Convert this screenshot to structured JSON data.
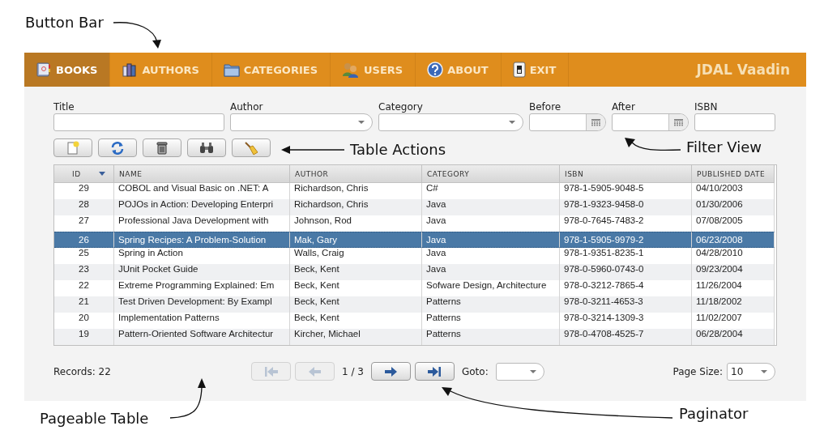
{
  "nav": {
    "tabs": [
      {
        "label": "BOOKS",
        "kind": "book",
        "selected": true
      },
      {
        "label": "AUTHORS",
        "kind": "authors",
        "selected": false
      },
      {
        "label": "CATEGORIES",
        "kind": "folder",
        "selected": false
      },
      {
        "label": "USERS",
        "kind": "users",
        "selected": false
      },
      {
        "label": "ABOUT",
        "kind": "help",
        "selected": false
      },
      {
        "label": "EXIT",
        "kind": "exit",
        "selected": false
      }
    ],
    "brand": "JDAL Vaadin"
  },
  "filters": [
    {
      "label": "Title",
      "kind": "text"
    },
    {
      "label": "Author",
      "kind": "select"
    },
    {
      "label": "Category",
      "kind": "select"
    },
    {
      "label": "Before",
      "kind": "date"
    },
    {
      "label": "After",
      "kind": "date"
    },
    {
      "label": "ISBN",
      "kind": "text"
    }
  ],
  "actions": [
    {
      "kind": "add"
    },
    {
      "kind": "refresh"
    },
    {
      "kind": "delete"
    },
    {
      "kind": "find"
    },
    {
      "kind": "clear"
    }
  ],
  "table": {
    "columns": [
      {
        "label": "ID",
        "sorted": true
      },
      {
        "label": "NAME",
        "sorted": false
      },
      {
        "label": "AUTHOR",
        "sorted": false
      },
      {
        "label": "CATEGORY",
        "sorted": false
      },
      {
        "label": "ISBN",
        "sorted": false
      },
      {
        "label": "PUBLISHED DATE",
        "sorted": false
      }
    ],
    "rows": [
      {
        "selected": false,
        "cells": [
          "29",
          "COBOL and Visual Basic on .NET: A",
          "Richardson, Chris",
          "C#",
          "978-1-5905-9048-5",
          "04/10/2003"
        ]
      },
      {
        "selected": false,
        "cells": [
          "28",
          "POJOs in Action: Developing Enterpri",
          "Richardson, Chris",
          "Java",
          "978-1-9323-9458-0",
          "01/30/2006"
        ]
      },
      {
        "selected": false,
        "cells": [
          "27",
          "Professional Java Development with",
          "Johnson, Rod",
          "Java",
          "978-0-7645-7483-2",
          "07/08/2005"
        ]
      },
      {
        "selected": true,
        "cells": [
          "26",
          "Spring Recipes: A Problem-Solution",
          "Mak, Gary",
          "Java",
          "978-1-5905-9979-2",
          "06/23/2008"
        ]
      },
      {
        "selected": false,
        "cells": [
          "25",
          "Spring in Action",
          "Walls, Craig",
          "Java",
          "978-1-9351-8235-1",
          "04/28/2010"
        ]
      },
      {
        "selected": false,
        "cells": [
          "23",
          "JUnit Pocket Guide",
          "Beck, Kent",
          "Java",
          "978-0-5960-0743-0",
          "09/23/2004"
        ]
      },
      {
        "selected": false,
        "cells": [
          "22",
          "Extreme Programming Explained: Em",
          "Beck, Kent",
          "Sofware Design, Architecture",
          "978-0-3212-7865-4",
          "11/26/2004"
        ]
      },
      {
        "selected": false,
        "cells": [
          "21",
          "Test Driven Development: By Exampl",
          "Beck, Kent",
          "Patterns",
          "978-0-3211-4653-3",
          "11/18/2002"
        ]
      },
      {
        "selected": false,
        "cells": [
          "20",
          "Implementation Patterns",
          "Beck, Kent",
          "Patterns",
          "978-0-3214-1309-3",
          "11/02/2007"
        ]
      },
      {
        "selected": false,
        "cells": [
          "19",
          "Pattern-Oriented Software Architectur",
          "Kircher, Michael",
          "Patterns",
          "978-0-4708-4525-7",
          "06/28/2004"
        ]
      }
    ]
  },
  "paginator": {
    "records": "Records: 22",
    "buttons": [
      {
        "kind": "first",
        "disabled": true
      },
      {
        "kind": "previous",
        "disabled": true
      },
      {
        "kind": "next",
        "disabled": false
      },
      {
        "kind": "last",
        "disabled": false
      }
    ],
    "page": "1 / 3",
    "goto_label": "Goto:",
    "page_size_label": "Page Size:",
    "page_size": "10"
  },
  "annotations": [
    {
      "kind": "button-bar",
      "text": "Button Bar"
    },
    {
      "kind": "table-actions",
      "text": "Table Actions"
    },
    {
      "kind": "filter-view",
      "text": "Filter View"
    },
    {
      "kind": "pageable-table",
      "text": "Pageable Table"
    },
    {
      "kind": "paginator",
      "text": "Paginator"
    }
  ]
}
